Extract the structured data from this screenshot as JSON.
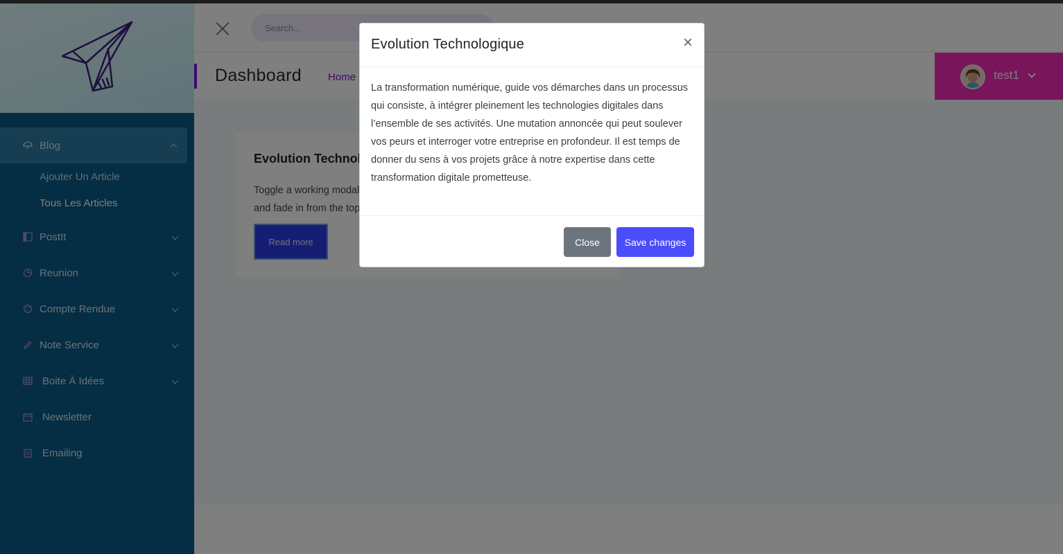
{
  "sidebar": {
    "logo_icon": "paper-plane-icon",
    "items": [
      {
        "label": "Blog",
        "icon": "umbrella-icon",
        "active": true
      },
      {
        "label": "PostIt",
        "icon": "layout-icon"
      },
      {
        "label": "Reunion",
        "icon": "pie-chart-icon"
      },
      {
        "label": "Compte Rendue",
        "icon": "palette-icon"
      },
      {
        "label": "Note Service",
        "icon": "pencil-icon"
      },
      {
        "label": "Boite À Idées",
        "icon": "table-icon"
      },
      {
        "label": "Newsletter",
        "icon": "calendar-icon"
      },
      {
        "label": "Emailing",
        "icon": "clipboard-icon"
      }
    ],
    "blog_sub": [
      {
        "label": "Ajouter Un Article"
      },
      {
        "label": "Tous Les Articles",
        "selected": true
      }
    ]
  },
  "topbar": {
    "search_placeholder": "Search..."
  },
  "header": {
    "title": "Dashboard",
    "breadcrumb": "Home",
    "user_name": "test1"
  },
  "card": {
    "title": "Evolution Technologique",
    "text": "Toggle a working modal demo by clicking the button below. It will slide down and fade in from the top of the page.",
    "button": "Read more"
  },
  "modal": {
    "title": "Evolution Technologique",
    "close_symbol": "×",
    "body": "La transformation numérique, guide vos démarches dans un processus qui consiste, à intégrer pleinement les technologies digitales dans l’ensemble de ses activités. Une mutation annoncée qui peut soulever vos peurs et interroger votre entreprise en profondeur. Il est temps de donner du sens à vos projets grâce à notre expertise dans cette transformation digitale prometteuse.",
    "close_button": "Close",
    "save_button": "Save changes"
  },
  "colors": {
    "sidebar": "#0b5a86",
    "accent_purple": "#7e12e0",
    "user_pink": "#f22ab4",
    "primary_button": "#4a4dfa",
    "secondary_button": "#6c757d"
  }
}
